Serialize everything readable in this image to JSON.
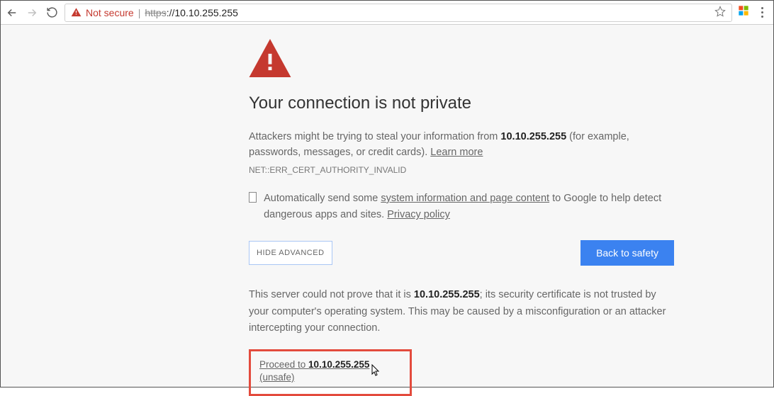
{
  "toolbar": {
    "not_secure": "Not secure",
    "scheme": "https",
    "sep": "://",
    "host": "10.10.255.255"
  },
  "page": {
    "heading": "Your connection is not private",
    "warn_pre": "Attackers might be trying to steal your information from ",
    "warn_host": "10.10.255.255",
    "warn_post": " (for example, passwords, messages, or credit cards). ",
    "learn_more": "Learn more",
    "error_code": "NET::ERR_CERT_AUTHORITY_INVALID",
    "optin_pre": "Automatically send some ",
    "optin_link1": "system information and page content",
    "optin_mid": " to Google to help detect dangerous apps and sites. ",
    "optin_link2": "Privacy policy",
    "hide_advanced": "HIDE ADVANCED",
    "back_to_safety": "Back to safety",
    "detail_pre": "This server could not prove that it is ",
    "detail_host": "10.10.255.255",
    "detail_post": "; its security certificate is not trusted by your computer's operating system. This may be caused by a misconfiguration or an attacker intercepting your connection.",
    "proceed_pre": "Proceed to ",
    "proceed_host": "10.10.255.255",
    "proceed_suffix": " (unsafe)"
  }
}
